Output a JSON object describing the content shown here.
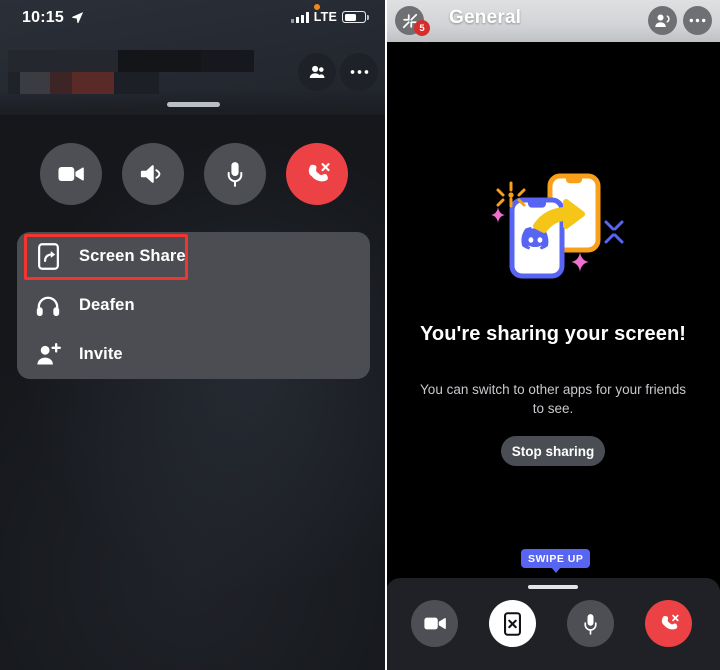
{
  "left_phone": {
    "status_bar": {
      "time": "10:15",
      "location_icon": "location-arrow-icon",
      "recording_dot": "orange-recording-dot",
      "signal_icon": "cellular-signal-bars-icon",
      "network": "LTE",
      "battery_icon": "battery-icon"
    },
    "channel_header": {
      "channel_name_redacted": "",
      "members_icon": "members-icon",
      "more_icon": "more-options-icon",
      "drag_handle": "drag-handle"
    },
    "call_controls": [
      {
        "name": "video-button",
        "icon": "video-camera-icon",
        "state": "off",
        "color": "#4d4f55"
      },
      {
        "name": "speaker-button",
        "icon": "speaker-icon",
        "state": "on",
        "color": "#4d4f55"
      },
      {
        "name": "mute-button",
        "icon": "microphone-icon",
        "state": "on",
        "color": "#4d4f55"
      },
      {
        "name": "hangup-button",
        "icon": "phone-hangup-icon",
        "state": "active",
        "color": "#ed4245"
      }
    ],
    "action_sheet": {
      "items": [
        {
          "label": "Screen Share",
          "icon": "screen-share-icon",
          "highlighted": true
        },
        {
          "label": "Deafen",
          "icon": "headphones-icon",
          "highlighted": false
        },
        {
          "label": "Invite",
          "icon": "person-add-icon",
          "highlighted": false
        }
      ],
      "highlight_color": "#f2352f"
    }
  },
  "right_phone": {
    "header": {
      "collapse_icon": "collapse-arrows-icon",
      "badge_count": "5",
      "title": "General",
      "members_icon": "members-speaking-icon",
      "more_icon": "more-options-icon"
    },
    "content": {
      "illustration": "screen-share-phones-illustration",
      "title": "You're sharing your screen!",
      "subtitle": "You can switch to other apps for your friends to see.",
      "stop_button": "Stop sharing"
    },
    "swipe_tip": "SWIPE UP",
    "bottom_controls": [
      {
        "name": "video-button",
        "icon": "video-camera-icon",
        "state": "off",
        "color": "#4d4f55"
      },
      {
        "name": "stop-share-button",
        "icon": "phone-stop-share-icon",
        "state": "active",
        "color": "#ffffff"
      },
      {
        "name": "mute-button",
        "icon": "microphone-icon",
        "state": "on",
        "color": "#4d4f55"
      },
      {
        "name": "hangup-button",
        "icon": "phone-hangup-icon",
        "state": "active",
        "color": "#ed4245"
      }
    ]
  },
  "colors": {
    "discord_blurple": "#5865f2",
    "danger_red": "#ed4245",
    "annotation_red": "#f2352f",
    "illustration_orange": "#f8a01b",
    "illustration_pink": "#f26fd2",
    "illustration_yellow": "#f5c518"
  }
}
